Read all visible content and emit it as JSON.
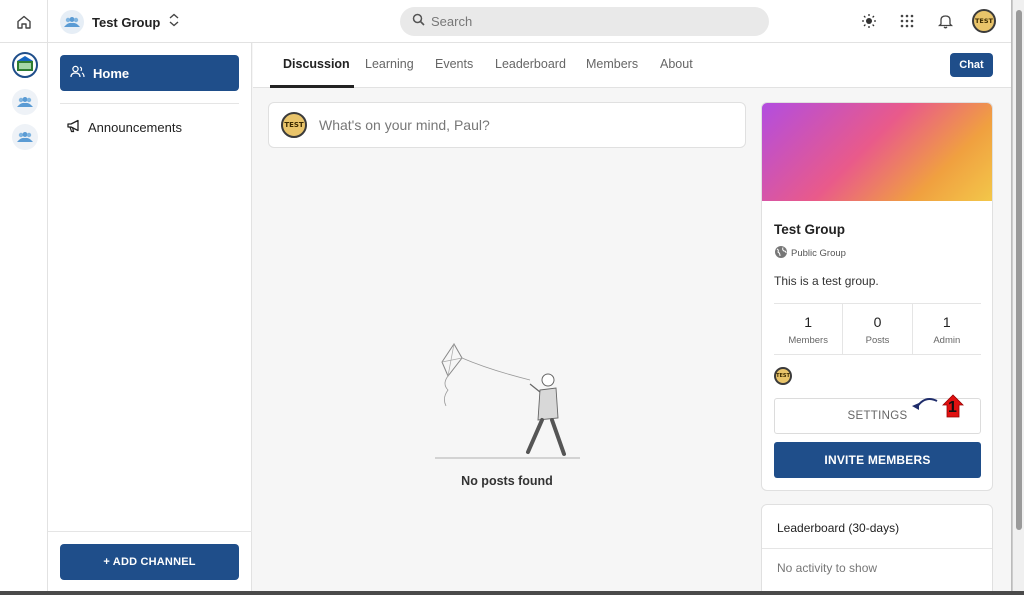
{
  "topbar": {
    "group_name": "Test Group",
    "search_placeholder": "Search",
    "avatar_text": "TEST"
  },
  "sidebar": {
    "home_label": "Home",
    "announcements_label": "Announcements",
    "add_channel_label": "+ ADD CHANNEL"
  },
  "tabs": [
    {
      "label": "Discussion",
      "active": true
    },
    {
      "label": "Learning",
      "active": false
    },
    {
      "label": "Events",
      "active": false
    },
    {
      "label": "Leaderboard",
      "active": false
    },
    {
      "label": "Members",
      "active": false
    },
    {
      "label": "About",
      "active": false
    }
  ],
  "chat_label": "Chat",
  "composer": {
    "placeholder": "What's on your mind, Paul?",
    "avatar_text": "TEST"
  },
  "feed": {
    "empty_text": "No posts found"
  },
  "group_card": {
    "title": "Test Group",
    "privacy": "Public Group",
    "description": "This is a test group.",
    "stats": [
      {
        "value": "1",
        "label": "Members"
      },
      {
        "value": "0",
        "label": "Posts"
      },
      {
        "value": "1",
        "label": "Admin"
      }
    ],
    "member_avatar_text": "TEST",
    "settings_label": "SETTINGS",
    "invite_label": "INVITE MEMBERS",
    "annotation_number": "1"
  },
  "leaderboard": {
    "title": "Leaderboard (30-days)",
    "empty_text": "No activity to show"
  },
  "colors": {
    "primary": "#1f4e8a",
    "annotation": "#e01010"
  }
}
